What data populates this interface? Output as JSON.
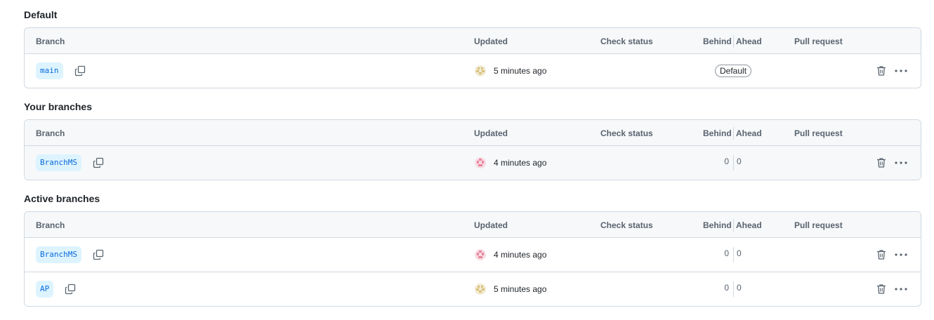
{
  "headers": {
    "branch": "Branch",
    "updated": "Updated",
    "check_status": "Check status",
    "behind": "Behind",
    "ahead": "Ahead",
    "pull_request": "Pull request"
  },
  "sections": [
    {
      "title": "Default",
      "rows": [
        {
          "branch": "main",
          "updated": "5 minutes ago",
          "avatar": "tan",
          "badge": "Default"
        }
      ]
    },
    {
      "title": "Your branches",
      "rows": [
        {
          "branch": "BranchMS",
          "updated": "4 minutes ago",
          "avatar": "pink",
          "behind": "0",
          "ahead": "0"
        }
      ]
    },
    {
      "title": "Active branches",
      "rows": [
        {
          "branch": "BranchMS",
          "updated": "4 minutes ago",
          "avatar": "pink",
          "behind": "0",
          "ahead": "0"
        },
        {
          "branch": "AP",
          "updated": "5 minutes ago",
          "avatar": "tan",
          "behind": "0",
          "ahead": "0"
        }
      ]
    }
  ],
  "colors": {
    "branch_pill_bg": "#ddf4ff",
    "branch_pill_text": "#0969da",
    "border": "#d1d9e0",
    "header_bg": "#f6f8fa",
    "avatar_tan": "#d9c07a",
    "avatar_pink": "#e8869e"
  },
  "icons": {
    "copy": "copy-icon",
    "trash": "trash-icon",
    "more": "kebab-horizontal-icon"
  }
}
